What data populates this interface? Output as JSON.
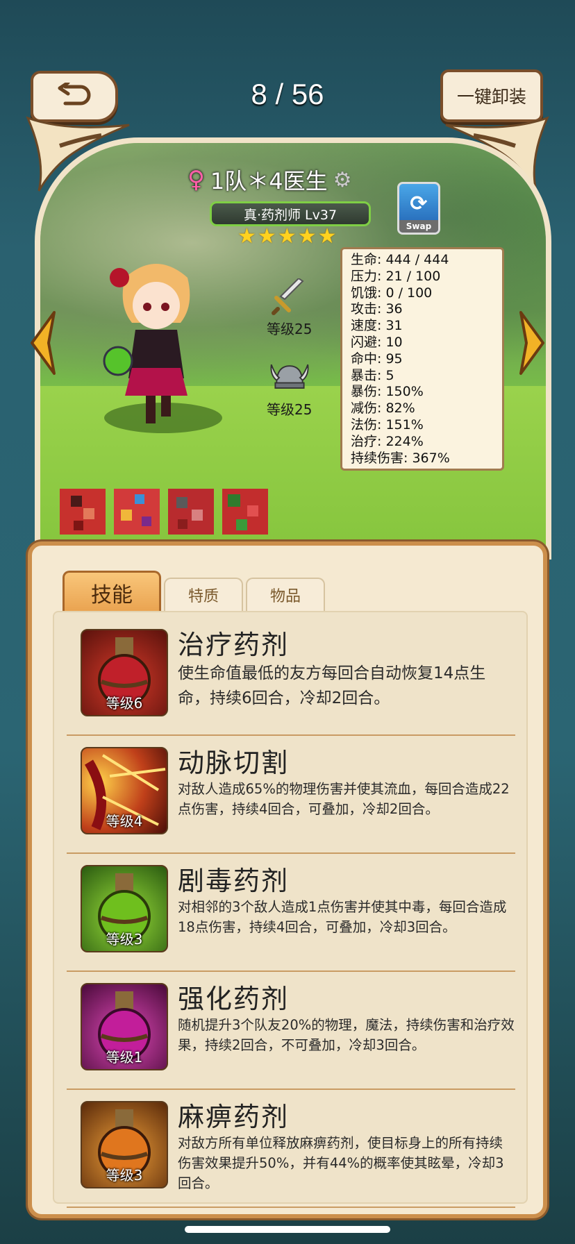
{
  "header": {
    "counter": "8 / 56",
    "unequip_label": "一键卸装"
  },
  "hero": {
    "name": "1队＊4医生",
    "gender_symbol": "♀",
    "class_label": "真·药剂师 Lv37",
    "stars": 5,
    "swap_label": "Swap",
    "weapon_level": "等级25",
    "helmet_level": "等级25"
  },
  "stats": [
    "生命: 444 / 444",
    "压力: 21 / 100",
    "饥饿: 0 / 100",
    "攻击: 36",
    "速度: 31",
    "闪避: 10",
    "命中: 95",
    "暴击: 5",
    "暴伤: 150%",
    "减伤: 82%",
    "法伤: 151%",
    "治疗: 224%",
    "持续伤害: 367%"
  ],
  "tabs": {
    "skills": "技能",
    "traits": "特质",
    "items": "物品"
  },
  "skills": [
    {
      "name": "治疗药剂",
      "level": "等级6",
      "desc": "使生命值最低的友方每回合自动恢复14点生命，持续6回合，冷却2回合。"
    },
    {
      "name": "动脉切割",
      "level": "等级4",
      "desc": "对敌人造成65%的物理伤害并使其流血，每回合造成22点伤害，持续4回合，可叠加，冷却2回合。"
    },
    {
      "name": "剧毒药剂",
      "level": "等级3",
      "desc": "对相邻的3个敌人造成1点伤害并使其中毒，每回合造成18点伤害，持续4回合，可叠加，冷却3回合。"
    },
    {
      "name": "强化药剂",
      "level": "等级1",
      "desc": "随机提升3个队友20%的物理，魔法，持续伤害和治疗效果，持续2回合，不可叠加，冷却3回合。"
    },
    {
      "name": "麻痹药剂",
      "level": "等级3",
      "desc": "对敌方所有单位释放麻痹药剂，使目标身上的所有持续伤害效果提升50%，并有44%的概率使其眩晕，冷却3回合。"
    }
  ],
  "colors": {
    "panel_border": "#cc8f4c",
    "panel_bg": "#f5e9d1",
    "star": "#ffd21f",
    "active_tab": "#e9a24f"
  }
}
